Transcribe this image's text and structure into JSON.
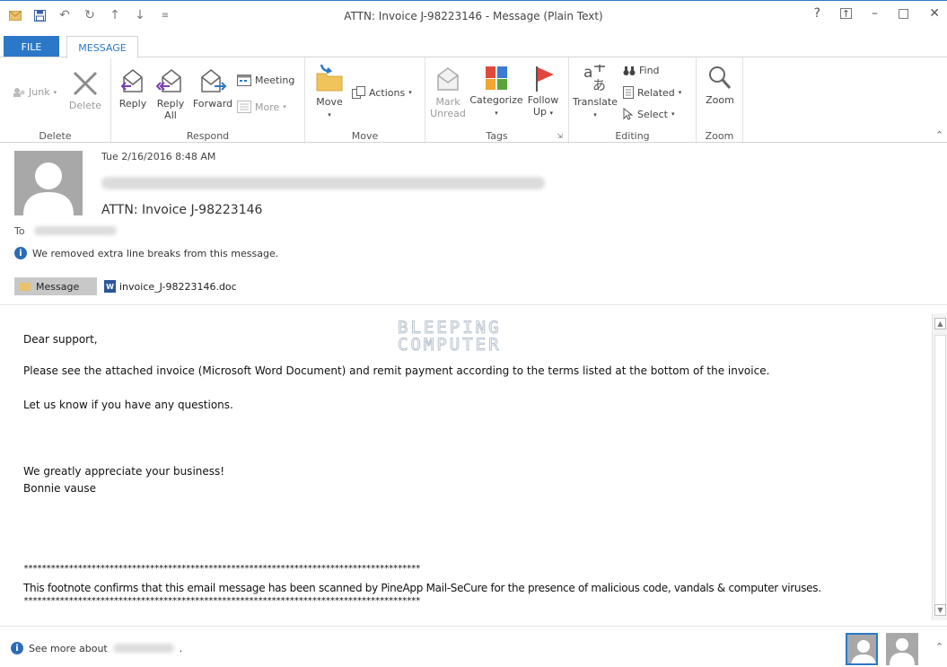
{
  "window": {
    "title": "ATTN: Invoice J-98223146 - Message (Plain Text)",
    "controls": {
      "help": "?",
      "ribbon_display": "↑",
      "minimize": "–",
      "maximize": "□",
      "close": "✕"
    }
  },
  "qat": {
    "icons": [
      "envelope-icon",
      "save-icon",
      "undo-icon",
      "redo-icon",
      "up-arrow-icon",
      "down-arrow-icon",
      "customize-icon"
    ]
  },
  "tabs": {
    "file": "FILE",
    "message": "MESSAGE"
  },
  "ribbon": {
    "delete_group": {
      "label": "Delete",
      "junk": "Junk",
      "delete": "Delete"
    },
    "respond_group": {
      "label": "Respond",
      "reply": "Reply",
      "reply_all_1": "Reply",
      "reply_all_2": "All",
      "forward": "Forward",
      "meeting": "Meeting",
      "more": "More"
    },
    "move_group": {
      "label": "Move",
      "move": "Move",
      "actions": "Actions"
    },
    "tags_group": {
      "label": "Tags",
      "mark_unread_1": "Mark",
      "mark_unread_2": "Unread",
      "categorize": "Categorize",
      "follow_up_1": "Follow",
      "follow_up_2": "Up"
    },
    "editing_group": {
      "label": "Editing",
      "translate": "Translate",
      "find": "Find",
      "related": "Related",
      "select": "Select"
    },
    "zoom_group": {
      "label": "Zoom",
      "zoom": "Zoom"
    }
  },
  "header": {
    "date": "Tue 2/16/2016 8:48 AM",
    "subject": "ATTN: Invoice J-98223146",
    "to_label": "To",
    "info": "We removed extra line breaks from this message.",
    "message_tab": "Message",
    "attachment": "invoice_J-98223146.doc"
  },
  "body": {
    "watermark_1": "BLEEPING",
    "watermark_2": "COMPUTER",
    "greeting": "Dear support,",
    "line1": "Please see the attached invoice (Microsoft Word Document) and remit payment according to the terms listed at the bottom of the invoice.",
    "line2": "Let us know if you have any questions.",
    "line3": "We greatly appreciate your business!",
    "signature": "Bonnie vause",
    "stars": "****************************************************************************************",
    "footnote": "This footnote confirms that this email message has been scanned by PineApp Mail-SeCure for the presence of malicious code, vandals & computer viruses."
  },
  "footer": {
    "see_more": "See more about",
    "period": "."
  },
  "colors": {
    "accent": "#2b78c8",
    "flag": "#e0483e",
    "envelope": "#e8c26a"
  }
}
